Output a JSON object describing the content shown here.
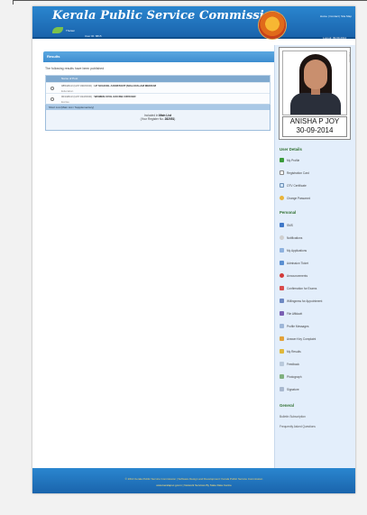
{
  "header": {
    "brand": "Kerala Public Service Commission",
    "sublogo_text": "Thulasi",
    "user_id": "User ID: 8815",
    "top_links": "Home | Contact | Site Map",
    "logout": "Logout: 09.09.2014"
  },
  "main": {
    "title": "Results",
    "intro": "The following results have been published",
    "table_head": "Name of Post",
    "rows": [
      {
        "l1_code": "085/2013 (CAT 030/KKD)",
        "l1_name": "LP SCHOOL ASSISTANT (MALAYALAM MEDIUM",
        "l2": "Education"
      },
      {
        "l1_code": "001/2013 (CAT 014/KKD)",
        "l1_name": "WOMEN CIVIL EXCISE OFFICER",
        "l2": "Excise"
      }
    ],
    "status_head": "Short List (Main List / Supplementary)",
    "status_line1_pre": "Included in ",
    "status_line1_b": "Main List",
    "status_line2_pre": "(Your Register No. ",
    "status_line2_b": "282051",
    "status_line2_post": ")"
  },
  "profile": {
    "name": "ANISHA P JOY",
    "date": "30-09-2014",
    "side_text": "PHOTO"
  },
  "sidebar": {
    "section_user": "User Details",
    "user_items": [
      "My Profile",
      "Registration Card",
      "OTV Certificate",
      "Change Password"
    ],
    "section_personal": "Personal",
    "personal_items": [
      "SMS",
      "Notifications",
      "My Applications",
      "Admission Ticket",
      "Announcements",
      "Confirmation for Exams",
      "Willingness for Appointment",
      "File Affidavit",
      "Profile Messages",
      "Answer Key Complaint",
      "My Results",
      "Feedback",
      "Photograph",
      "Signature"
    ],
    "section_general": "General",
    "general_items": [
      "Bulletin Subscription",
      "Frequently Asked Questions"
    ]
  },
  "footer": {
    "line1": "© 2014 Kerala Public Service Commission | Software Design and Development: Kerala Public Service Commission",
    "line2": "www.keralapsc.gov.in | Network Services By State Data Centre"
  },
  "colors": {
    "header_blue": "#1f74bf",
    "section_green": "#2e6e2e",
    "sidebar_bg": "#e3eefb"
  }
}
